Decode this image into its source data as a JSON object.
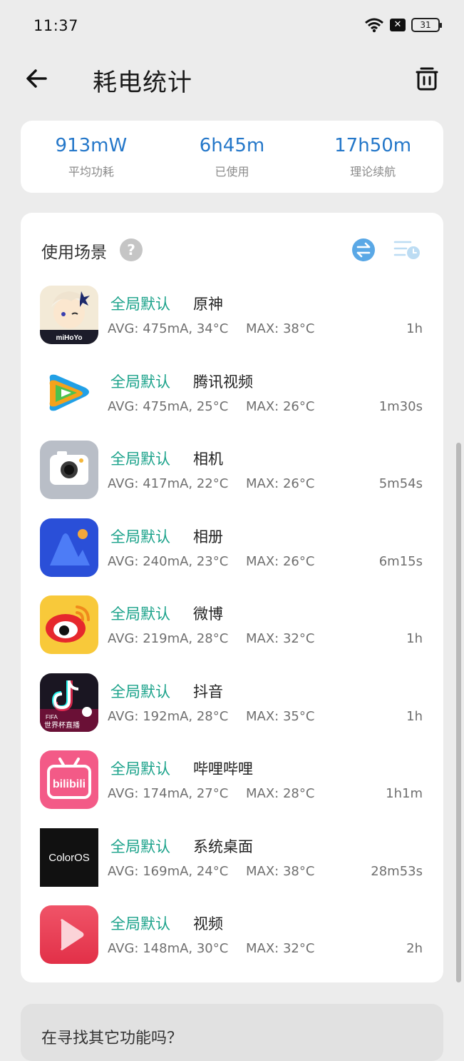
{
  "status_bar": {
    "time": "11:37",
    "battery": "31",
    "icons": [
      "wifi-icon",
      "sim-off-icon",
      "battery-icon"
    ]
  },
  "header": {
    "title": "耗电统计",
    "back_icon": "back-arrow-icon",
    "trash_icon": "trash-icon"
  },
  "summary": [
    {
      "value": "913mW",
      "label": "平均功耗"
    },
    {
      "value": "6h45m",
      "label": "已使用"
    },
    {
      "value": "17h50m",
      "label": "理论续航"
    }
  ],
  "scenes": {
    "title": "使用场景",
    "help": "?",
    "apps": [
      {
        "mode": "全局默认",
        "name": "原神",
        "avg": "AVG: 475mA, 34°C",
        "max": "MAX:  38°C",
        "duration": "1h",
        "icon": "genshin"
      },
      {
        "mode": "全局默认",
        "name": "腾讯视频",
        "avg": "AVG: 475mA, 25°C",
        "max": "MAX:  26°C",
        "duration": "1m30s",
        "icon": "tencent-video"
      },
      {
        "mode": "全局默认",
        "name": "相机",
        "avg": "AVG: 417mA, 22°C",
        "max": "MAX:  26°C",
        "duration": "5m54s",
        "icon": "camera"
      },
      {
        "mode": "全局默认",
        "name": "相册",
        "avg": "AVG: 240mA, 23°C",
        "max": "MAX:  26°C",
        "duration": "6m15s",
        "icon": "photos"
      },
      {
        "mode": "全局默认",
        "name": "微博",
        "avg": "AVG: 219mA, 28°C",
        "max": "MAX:  32°C",
        "duration": "1h",
        "icon": "weibo"
      },
      {
        "mode": "全局默认",
        "name": "抖音",
        "avg": "AVG: 192mA, 28°C",
        "max": "MAX:  35°C",
        "duration": "1h",
        "icon": "douyin"
      },
      {
        "mode": "全局默认",
        "name": "哔哩哔哩",
        "avg": "AVG: 174mA, 27°C",
        "max": "MAX:  28°C",
        "duration": "1h1m",
        "icon": "bilibili"
      },
      {
        "mode": "全局默认",
        "name": "系统桌面",
        "avg": "AVG: 169mA, 24°C",
        "max": "MAX:  38°C",
        "duration": "28m53s",
        "icon": "coloros"
      },
      {
        "mode": "全局默认",
        "name": "视频",
        "avg": "AVG: 148mA, 30°C",
        "max": "MAX:  32°C",
        "duration": "2h",
        "icon": "video"
      }
    ]
  },
  "icon_text": {
    "genshin_logo": "miHoYo",
    "douyin_badge": "FIFA",
    "douyin_caption": "世界杯直播",
    "bilibili_logo": "bilibili",
    "coloros_logo": "ColorOS"
  },
  "more": {
    "text": "在寻找其它功能吗？"
  },
  "colors": {
    "accent_blue": "#2477c9",
    "mode_green": "#1aa28a",
    "background": "#ececec"
  }
}
